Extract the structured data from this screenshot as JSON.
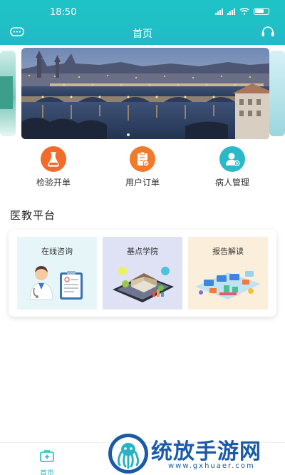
{
  "status": {
    "time": "18:50"
  },
  "header": {
    "title": "首页"
  },
  "actions": [
    {
      "label": "检验开单",
      "icon": "flask-icon",
      "color": "#f36b2a"
    },
    {
      "label": "用户订单",
      "icon": "clipboard-icon",
      "color": "#f07a2b"
    },
    {
      "label": "病人管理",
      "icon": "patient-icon",
      "color": "#29b9c7"
    }
  ],
  "section": {
    "title": "医教平台"
  },
  "cards": [
    {
      "label": "在线咨询",
      "bg": "#e6f6f8"
    },
    {
      "label": "基点学院",
      "bg": "#dfe1f4"
    },
    {
      "label": "报告解读",
      "bg": "#fbefdc"
    }
  ],
  "bottom_nav": {
    "home_label": "首页",
    "accent": "#23b8c3"
  },
  "watermark": {
    "text": "统放手游网",
    "url": "www.gxhuaer.com"
  },
  "colors": {
    "header": "#1fc3c6"
  }
}
